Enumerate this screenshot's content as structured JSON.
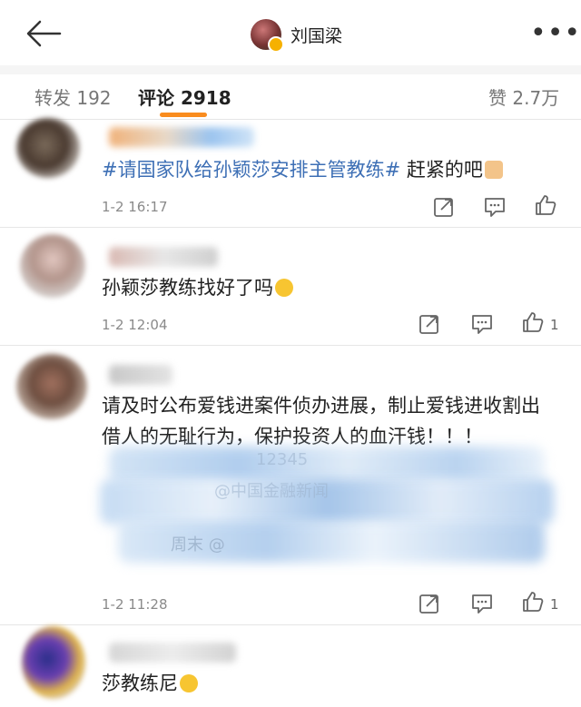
{
  "header": {
    "author_name": "刘国梁",
    "back_icon": "back-arrow-icon",
    "more_icon": "more-dots-icon",
    "more_label": "•••"
  },
  "tabs": {
    "repost": "转发 192",
    "comment": "评论 2918",
    "like": "赞 2.7万"
  },
  "comments": [
    {
      "hashtag": "#请国家队给孙颖莎安排主管教练#",
      "text": " 赶紧的吧",
      "emoji": "pray",
      "time": "1-2 16:17",
      "likes": ""
    },
    {
      "text": "孙颖莎教练找好了吗",
      "emoji": "sob",
      "time": "1-2 12:04",
      "likes": "1"
    },
    {
      "text_line1": "请及时公布爱钱进案件侦办进展，制止爱钱进收割出",
      "text_line2": "借人的无耻行为，保护投资人的血汗钱！！！",
      "obscured1": "12345",
      "obscured2": "@中国金融新闻",
      "obscured3": "周末 @",
      "time": "1-2 11:28",
      "likes": "1"
    },
    {
      "text": "莎教练尼",
      "emoji": "hug"
    }
  ],
  "colors": {
    "accent": "#f98c1e",
    "hashtag": "#3d6fb5",
    "timestamp": "#8a8a8a"
  }
}
